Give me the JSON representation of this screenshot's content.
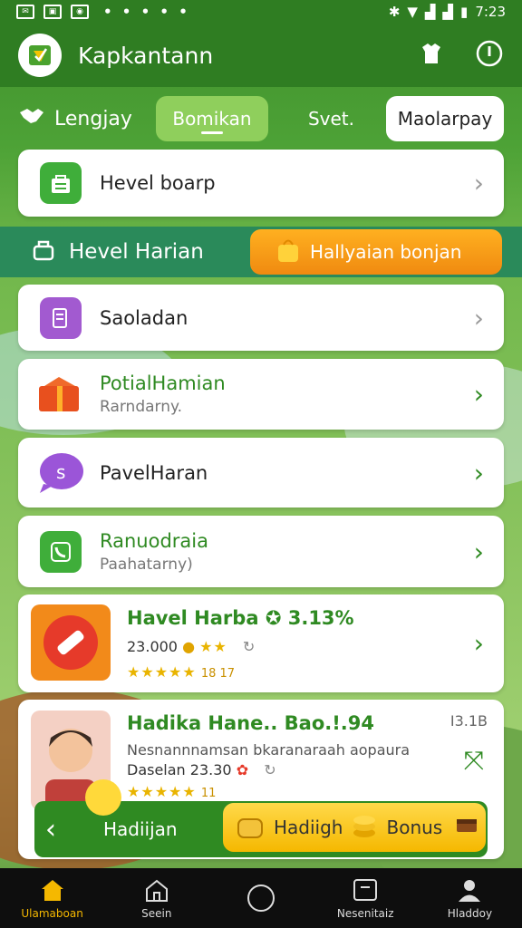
{
  "status_bar": {
    "time": "7:23",
    "dots": "• • • • •"
  },
  "app": {
    "title": "Kapkantann"
  },
  "tabs": [
    {
      "label": "Lengjay"
    },
    {
      "label": "Bomikan"
    },
    {
      "label": "Svet."
    },
    {
      "label": "Maolarpay"
    }
  ],
  "top_card": {
    "title": "Hevel boarp"
  },
  "banner": {
    "title": "Hevel Harian",
    "button_label": "Hallyaian bonjan"
  },
  "list": [
    {
      "title": "Saoladan"
    },
    {
      "title": "PotialHamian",
      "sub": "Rarndarny."
    },
    {
      "title": "PavelHaran"
    },
    {
      "title": "Ranuodraia",
      "sub": "Paahatarny)"
    }
  ],
  "promo1": {
    "title": "Havel Harba",
    "percent": "3.13%",
    "amount": "23.000",
    "rating_text": "18 17"
  },
  "promo2": {
    "title": "Hadika Hane..",
    "badge": "Bao.!.94",
    "corner": "I3.1B",
    "line1": "Nesnannnamsan bkaranaraah aopaura",
    "line2": "Daselan 23.30",
    "rating_num": "11"
  },
  "floatbar": {
    "label": "Hadiijan",
    "btn_label1": "Hadiigh",
    "btn_label2": "Bonus"
  },
  "nav": [
    {
      "label": "Ulamaboan"
    },
    {
      "label": "Seein"
    },
    {
      "label": ""
    },
    {
      "label": "Nesenitaiz"
    },
    {
      "label": "Hladdoy"
    }
  ],
  "colors": {
    "primary_green": "#2f7d22",
    "accent_orange": "#f08a10",
    "accent_yellow": "#f5b800"
  }
}
